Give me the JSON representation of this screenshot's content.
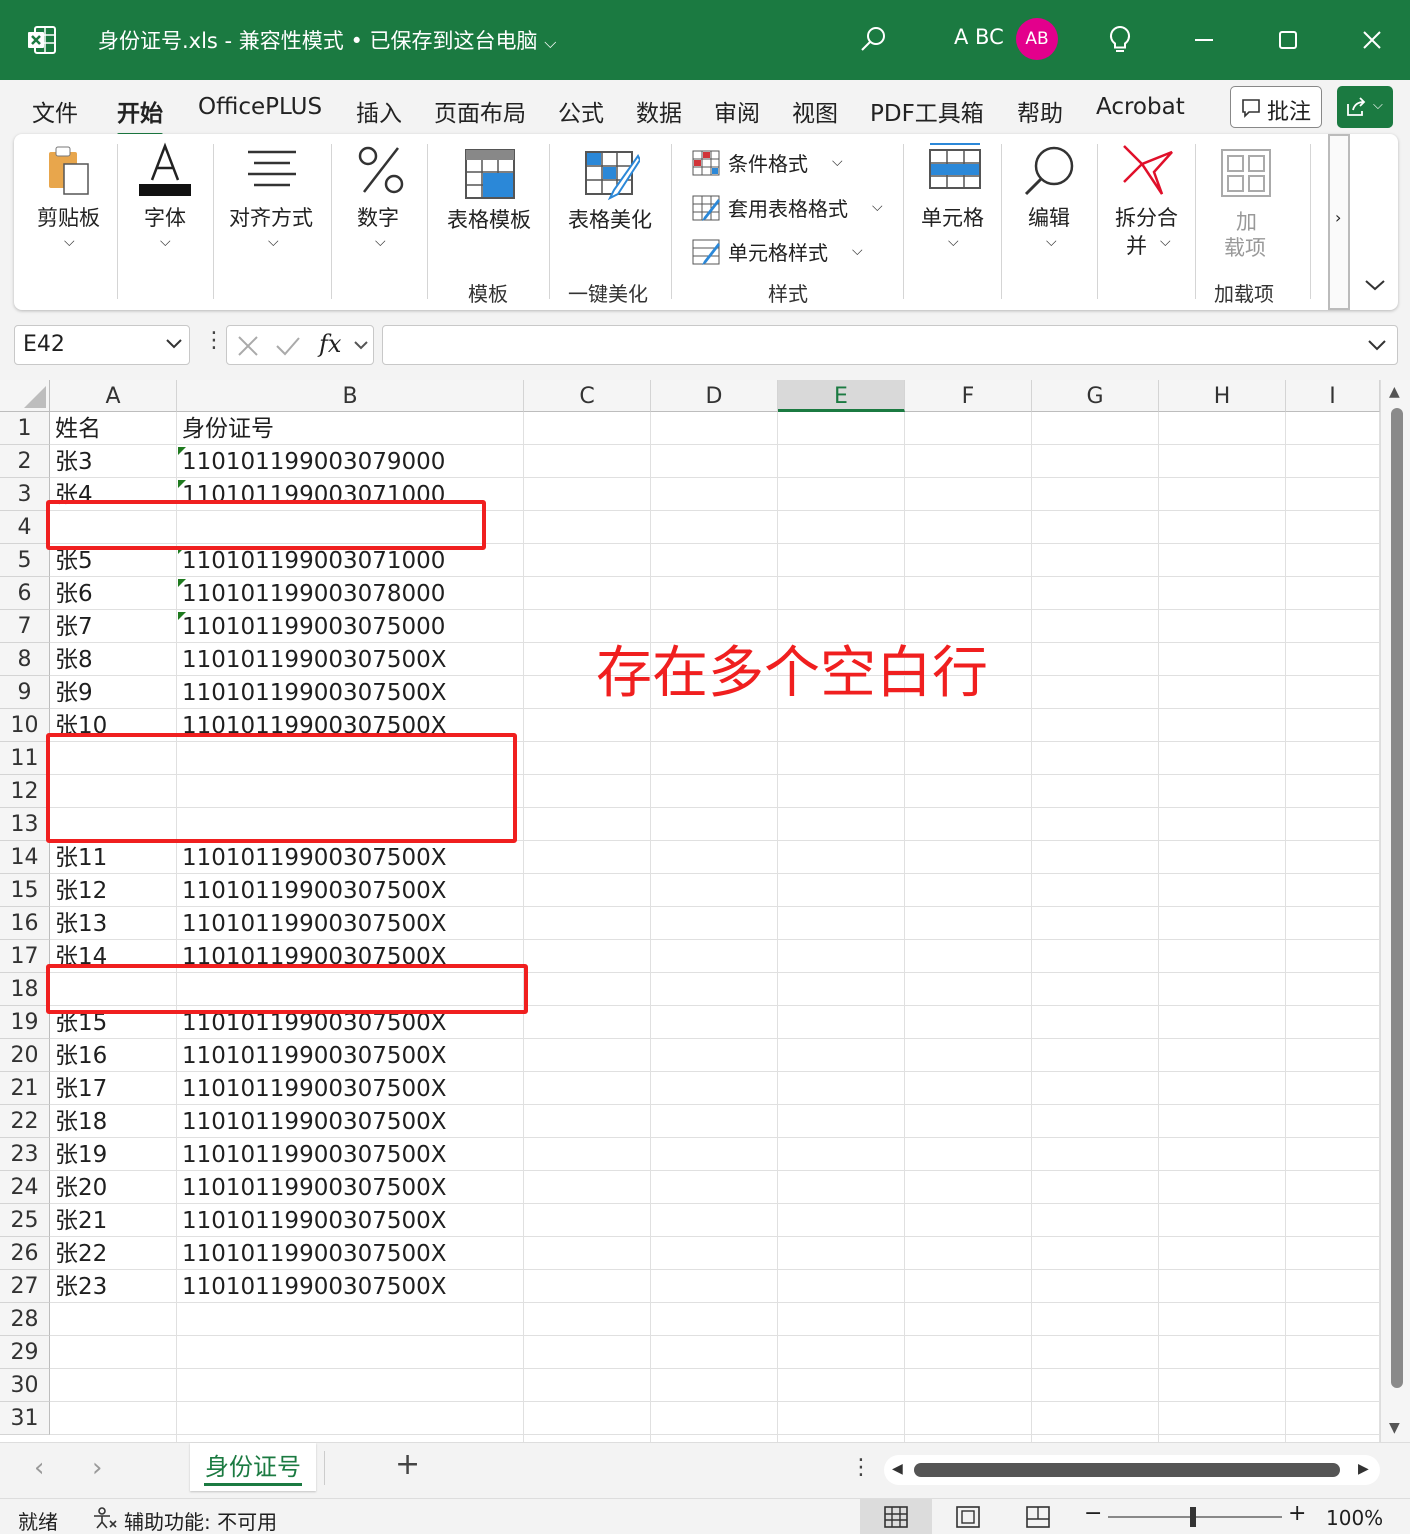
{
  "titlebar": {
    "doc_title": "身份证号.xls  -  兼容性模式 • 已保存到这台电脑",
    "user_name": "A BC",
    "avatar_initials": "AB",
    "bg_color": "#1b7a41",
    "avatar_color": "#e3008c"
  },
  "tabs": [
    "文件",
    "开始",
    "OfficePLUS",
    "插入",
    "页面布局",
    "公式",
    "数据",
    "审阅",
    "视图",
    "PDF工具箱",
    "帮助",
    "Acrobat"
  ],
  "active_tab": "开始",
  "comment_button": "批注",
  "ribbon": {
    "clipboard": "剪贴板",
    "font": "字体",
    "align": "对齐方式",
    "number": "数字",
    "table_template": "表格模板",
    "template_group": "模板",
    "table_beautify": "表格美化",
    "beautify_group": "一键美化",
    "conditional_format": "条件格式",
    "table_format": "套用表格格式",
    "cell_style": "单元格样式",
    "style_group": "样式",
    "cells": "单元格",
    "edit": "编辑",
    "split_merge_1": "拆分合",
    "split_merge_2": "并",
    "addin_1": "加",
    "addin_2": "载项",
    "addin_group": "加载项"
  },
  "formula_bar": {
    "name_box": "E42",
    "fx": "fx",
    "formula": ""
  },
  "columns": [
    "A",
    "B",
    "C",
    "D",
    "E",
    "F",
    "G",
    "H",
    "I"
  ],
  "selected_column": "E",
  "rows": [
    {
      "n": "1",
      "a": "姓名",
      "b": "身份证号",
      "tri": false
    },
    {
      "n": "2",
      "a": "张3",
      "b": "110101199003079000",
      "tri": true
    },
    {
      "n": "3",
      "a": "张4",
      "b": "110101199003071000",
      "tri": true
    },
    {
      "n": "4",
      "a": "",
      "b": "",
      "tri": false
    },
    {
      "n": "5",
      "a": "张5",
      "b": "110101199003071000",
      "tri": true
    },
    {
      "n": "6",
      "a": "张6",
      "b": "110101199003078000",
      "tri": true
    },
    {
      "n": "7",
      "a": "张7",
      "b": "110101199003075000",
      "tri": true
    },
    {
      "n": "8",
      "a": "张8",
      "b": "11010119900307500X",
      "tri": false
    },
    {
      "n": "9",
      "a": "张9",
      "b": "11010119900307500X",
      "tri": false
    },
    {
      "n": "10",
      "a": "张10",
      "b": "11010119900307500X",
      "tri": false
    },
    {
      "n": "11",
      "a": "",
      "b": "",
      "tri": false
    },
    {
      "n": "12",
      "a": "",
      "b": "",
      "tri": false
    },
    {
      "n": "13",
      "a": "",
      "b": "",
      "tri": false
    },
    {
      "n": "14",
      "a": "张11",
      "b": "11010119900307500X",
      "tri": false
    },
    {
      "n": "15",
      "a": "张12",
      "b": "11010119900307500X",
      "tri": false
    },
    {
      "n": "16",
      "a": "张13",
      "b": "11010119900307500X",
      "tri": false
    },
    {
      "n": "17",
      "a": "张14",
      "b": "11010119900307500X",
      "tri": false
    },
    {
      "n": "18",
      "a": "",
      "b": "",
      "tri": false
    },
    {
      "n": "19",
      "a": "张15",
      "b": "11010119900307500X",
      "tri": false
    },
    {
      "n": "20",
      "a": "张16",
      "b": "11010119900307500X",
      "tri": false
    },
    {
      "n": "21",
      "a": "张17",
      "b": "11010119900307500X",
      "tri": false
    },
    {
      "n": "22",
      "a": "张18",
      "b": "11010119900307500X",
      "tri": false
    },
    {
      "n": "23",
      "a": "张19",
      "b": "11010119900307500X",
      "tri": false
    },
    {
      "n": "24",
      "a": "张20",
      "b": "11010119900307500X",
      "tri": false
    },
    {
      "n": "25",
      "a": "张21",
      "b": "11010119900307500X",
      "tri": false
    },
    {
      "n": "26",
      "a": "张22",
      "b": "11010119900307500X",
      "tri": false
    },
    {
      "n": "27",
      "a": "张23",
      "b": "11010119900307500X",
      "tri": false
    },
    {
      "n": "28",
      "a": "",
      "b": "",
      "tri": false
    },
    {
      "n": "29",
      "a": "",
      "b": "",
      "tri": false
    },
    {
      "n": "30",
      "a": "",
      "b": "",
      "tri": false
    },
    {
      "n": "31",
      "a": "",
      "b": "",
      "tri": false
    }
  ],
  "annotation": "存在多个空白行",
  "annotation_color": "#f01f1f",
  "sheet_tab": "身份证号",
  "statusbar": {
    "ready": "就绪",
    "accessibility": "辅助功能: 不可用",
    "zoom": "100%"
  }
}
